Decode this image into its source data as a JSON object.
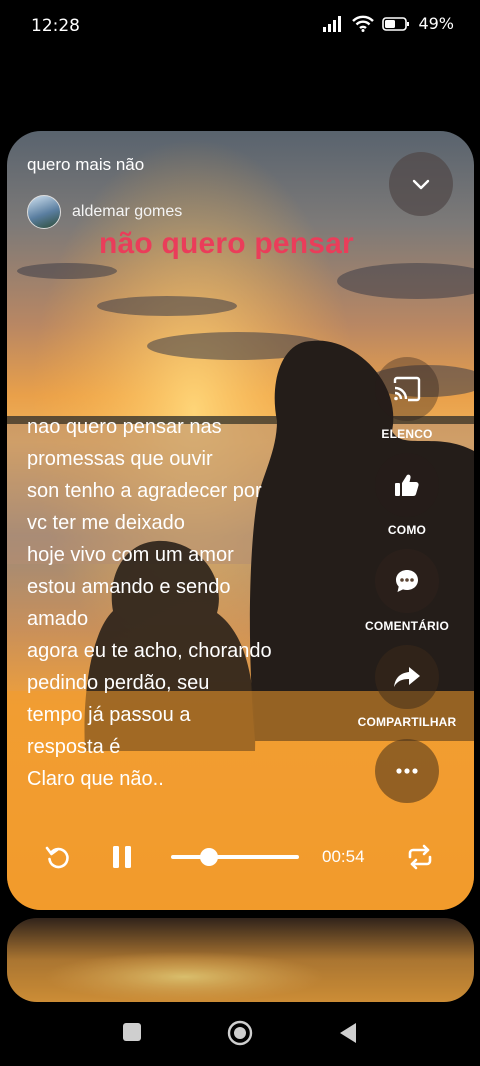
{
  "status_bar": {
    "time": "12:28",
    "battery": "49%"
  },
  "player": {
    "song_title": "quero mais não",
    "author": "aldemar gomes",
    "overlay_title": "não quero pensar",
    "lyrics": [
      "nao quero pensar nas",
      "promessas que ouvir",
      "son tenho a agradecer por",
      "vc ter me deixado",
      "hoje vivo com um amor",
      "estou amando e sendo",
      "amado",
      "agora eu te acho, chorando",
      "pedindo perdão, seu",
      "tempo já passou a",
      "resposta é",
      "Claro que não.."
    ],
    "elapsed": "00:54",
    "progress": 0.3
  },
  "actions": {
    "cast_label": "ELENCO",
    "like_label": "COMO",
    "comment_label": "COMENTÁRIO",
    "share_label": "COMPARTILHAR"
  },
  "icons": {
    "collapse": "chevron-down-icon",
    "cast": "cast-icon",
    "like": "thumbs-up-icon",
    "comment": "comment-icon",
    "share": "share-icon",
    "more": "more-icon",
    "replay": "replay-icon",
    "pause": "pause-icon",
    "repeat": "repeat-icon"
  },
  "colors": {
    "accent_title": "#ea3d5a",
    "card_bottom": "#f29b2c"
  }
}
